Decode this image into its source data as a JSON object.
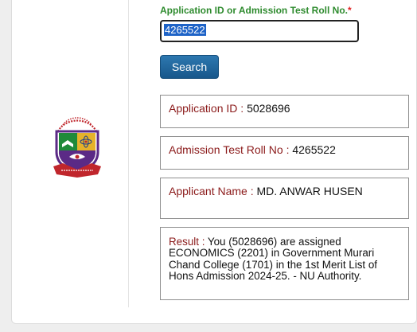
{
  "form": {
    "label": "Application ID or Admission Test Roll No.",
    "required_marker": "*",
    "input_value": "4265522",
    "search_label": "Search"
  },
  "results": {
    "application_id": {
      "label": "Application ID",
      "value": "5028696"
    },
    "roll_no": {
      "label": "Admission Test Roll No",
      "value": "4265522"
    },
    "applicant_name": {
      "label": "Applicant Name",
      "value": "MD. ANWAR HUSEN"
    },
    "result": {
      "label": "Result",
      "value": "You (5028696) are assigned ECONOMICS (2201) in Government Murari Chand College (1701) in the 1st Merit List of Hons Admission 2024-25. - NU Authority."
    }
  },
  "logo": {
    "icon": "national-university-logo",
    "colors": {
      "red": "#c0262c",
      "green": "#1f8a3a",
      "purple": "#5b2a86",
      "gold": "#e5b22a"
    }
  }
}
